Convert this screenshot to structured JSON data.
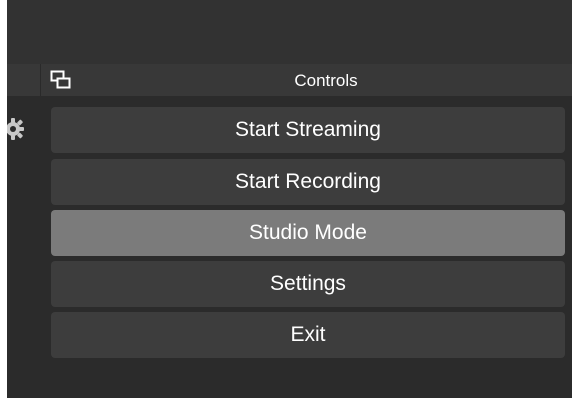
{
  "dock": {
    "title": "Controls"
  },
  "controls": {
    "buttons": [
      {
        "label": "Start Streaming",
        "active": false
      },
      {
        "label": "Start Recording",
        "active": false
      },
      {
        "label": "Studio Mode",
        "active": true
      },
      {
        "label": "Settings",
        "active": false
      },
      {
        "label": "Exit",
        "active": false
      }
    ]
  },
  "colors": {
    "panel_bg": "#2b2b2b",
    "header_bg": "#383838",
    "button_bg": "#3d3d3d",
    "button_active_bg": "#7b7b7b",
    "text": "#ffffff"
  },
  "icons": {
    "float": "dock-float-icon",
    "settings": "gear-icon"
  }
}
